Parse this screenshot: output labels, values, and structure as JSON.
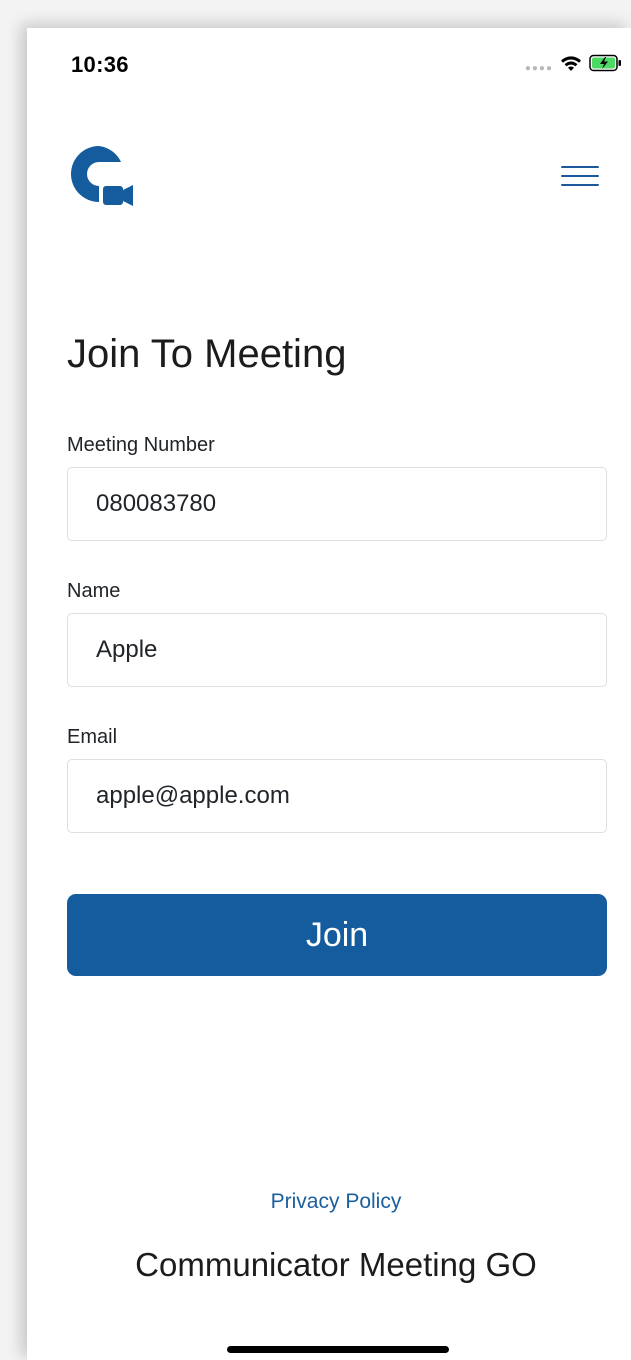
{
  "status_bar": {
    "time": "10:36",
    "signal_icon": "signal-dots-icon",
    "wifi_icon": "wifi-icon",
    "battery_icon": "battery-charging-icon",
    "battery_color": "#4cd964"
  },
  "header": {
    "logo_icon": "video-camera-logo-icon",
    "menu_icon": "hamburger-menu-icon",
    "brand_color": "#145c9e"
  },
  "form": {
    "title": "Join To Meeting",
    "meeting_number_label": "Meeting Number",
    "meeting_number_value": "080083780",
    "name_label": "Name",
    "name_value": "Apple",
    "email_label": "Email",
    "email_value": "apple@apple.com",
    "join_label": "Join"
  },
  "footer": {
    "privacy_label": "Privacy Policy",
    "app_name": "Communicator Meeting GO"
  }
}
